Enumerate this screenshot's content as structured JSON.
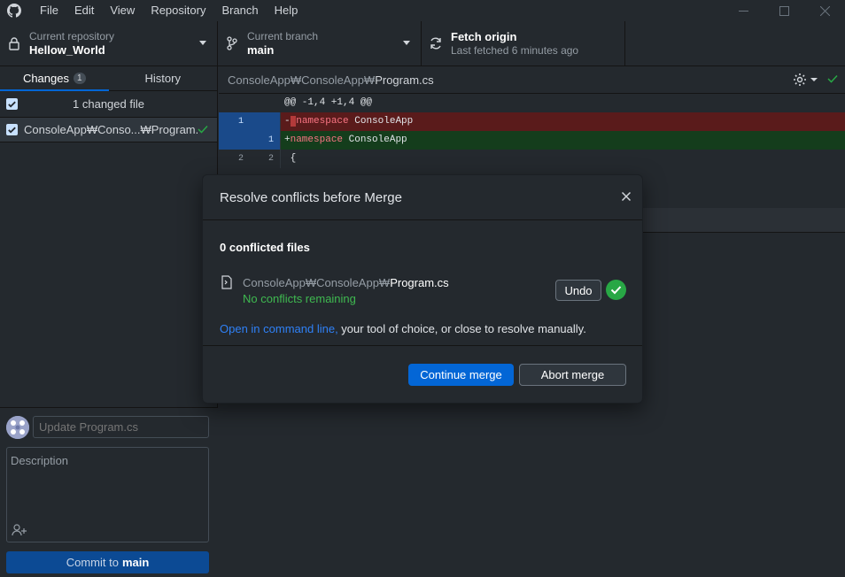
{
  "menu": [
    "File",
    "Edit",
    "View",
    "Repository",
    "Branch",
    "Help"
  ],
  "toolbar": {
    "repo_label": "Current repository",
    "repo_name": "Hellow_World",
    "branch_label": "Current branch",
    "branch_name": "main",
    "fetch_title": "Fetch origin",
    "fetch_sub": "Last fetched 6 minutes ago"
  },
  "tabs": {
    "changes": "Changes",
    "changes_count": "1",
    "history": "History"
  },
  "changes": {
    "header": "1 changed file",
    "file_path": "ConsoleApp₩Conso...₩Program.cs"
  },
  "commit": {
    "summary_placeholder": "Update Program.cs",
    "description_placeholder": "Description",
    "button_prefix": "Commit to",
    "button_branch": "main"
  },
  "diff": {
    "path_prefix": "ConsoleApp₩ConsoleApp₩",
    "file_name": "Program.cs",
    "hunk": "@@ -1,4 +1,4 @@",
    "lines": [
      {
        "old": "1",
        "new": "",
        "sign": "-",
        "kw": "namespace",
        "rest": " ConsoleApp"
      },
      {
        "old": "",
        "new": "1",
        "sign": "+",
        "kw": "namespace",
        "rest": " ConsoleApp"
      },
      {
        "old": "2",
        "new": "2",
        "sign": " ",
        "kw": "",
        "rest": "{"
      }
    ]
  },
  "dialog": {
    "title": "Resolve conflicts before Merge",
    "conflict_count": "0 conflicted files",
    "file_prefix": "ConsoleApp₩ConsoleApp₩",
    "file_name": "Program.cs",
    "status": "No conflicts remaining",
    "undo": "Undo",
    "help_link": "Open in command line,",
    "help_rest": " your tool of choice, or close to resolve manually.",
    "continue": "Continue merge",
    "abort": "Abort merge"
  },
  "colors": {
    "accent": "#0366d6",
    "success": "#28a745",
    "link": "#2f81f7",
    "background": "#24292e"
  }
}
